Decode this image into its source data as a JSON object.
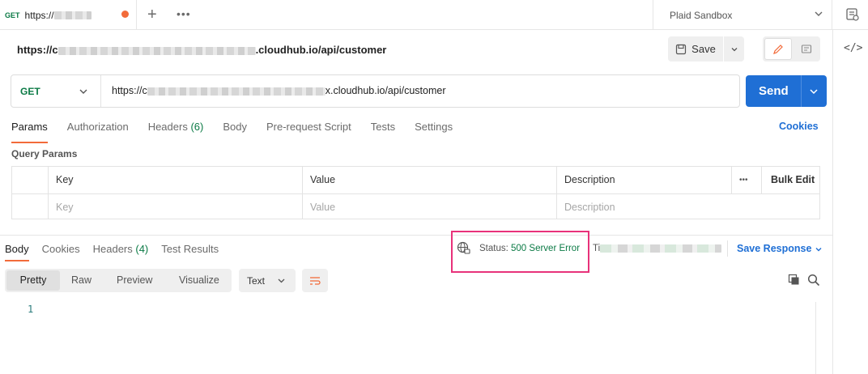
{
  "tab": {
    "method": "GET",
    "url_prefix": "https://"
  },
  "environment": {
    "name": "Plaid Sandbox"
  },
  "request": {
    "title_prefix": "https://c",
    "title_suffix": ".cloudhub.io/api/customer",
    "method": "GET",
    "url_prefix": "https://c",
    "url_suffix": "x.cloudhub.io/api/customer"
  },
  "toolbar": {
    "save_label": "Save",
    "send_label": "Send"
  },
  "request_tabs": [
    {
      "label": "Params"
    },
    {
      "label": "Authorization"
    },
    {
      "label": "Headers",
      "count": "(6)"
    },
    {
      "label": "Body"
    },
    {
      "label": "Pre-request Script"
    },
    {
      "label": "Tests"
    },
    {
      "label": "Settings"
    }
  ],
  "cookies_link": "Cookies",
  "query_params": {
    "title": "Query Params",
    "headers": {
      "key": "Key",
      "value": "Value",
      "description": "Description",
      "more": "•••",
      "bulk_edit": "Bulk Edit"
    },
    "placeholders": {
      "key": "Key",
      "value": "Value",
      "description": "Description"
    }
  },
  "response_tabs": [
    {
      "label": "Body"
    },
    {
      "label": "Cookies"
    },
    {
      "label": "Headers",
      "count": "(4)"
    },
    {
      "label": "Test Results"
    }
  ],
  "response": {
    "status_label": "Status:",
    "status_value": "500 Server Error",
    "time_prefix": "Ti",
    "save_response": "Save Response",
    "format_options": [
      "Pretty",
      "Raw",
      "Preview",
      "Visualize"
    ],
    "text_format": "Text",
    "line_numbers": [
      "1"
    ]
  },
  "colors": {
    "accent": "#f26b3a",
    "send": "#1f6fd5",
    "get": "#0b7a45",
    "highlight": "#e8327a"
  }
}
